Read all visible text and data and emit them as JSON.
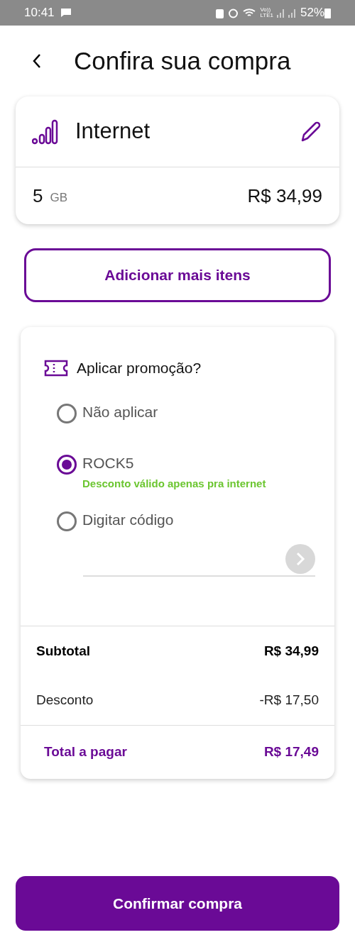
{
  "status_bar": {
    "time": "10:41",
    "volte_top": "Vo))",
    "volte_bottom": "LTE1",
    "battery": "52%"
  },
  "header": {
    "title": "Confira sua compra"
  },
  "item": {
    "name": "Internet",
    "quantity": "5",
    "unit": "GB",
    "price": "R$ 34,99"
  },
  "add_button": "Adicionar mais itens",
  "promo": {
    "title": "Aplicar promoção?",
    "options": [
      {
        "label": "Não aplicar",
        "selected": false
      },
      {
        "label": "ROCK5",
        "note": "Desconto válido apenas pra internet",
        "selected": true
      },
      {
        "label": "Digitar código",
        "selected": false
      }
    ],
    "code_submit": {
      "disabled": true
    }
  },
  "summary": [
    {
      "kind": "subtotal",
      "label": "Subtotal",
      "value": "R$ 34,99"
    },
    {
      "kind": "discount",
      "label": "Desconto",
      "value": "-R$ 17,50"
    },
    {
      "kind": "total",
      "label": "Total a pagar",
      "value": "R$ 17,49"
    }
  ],
  "confirm_button": "Confirmar compra"
}
